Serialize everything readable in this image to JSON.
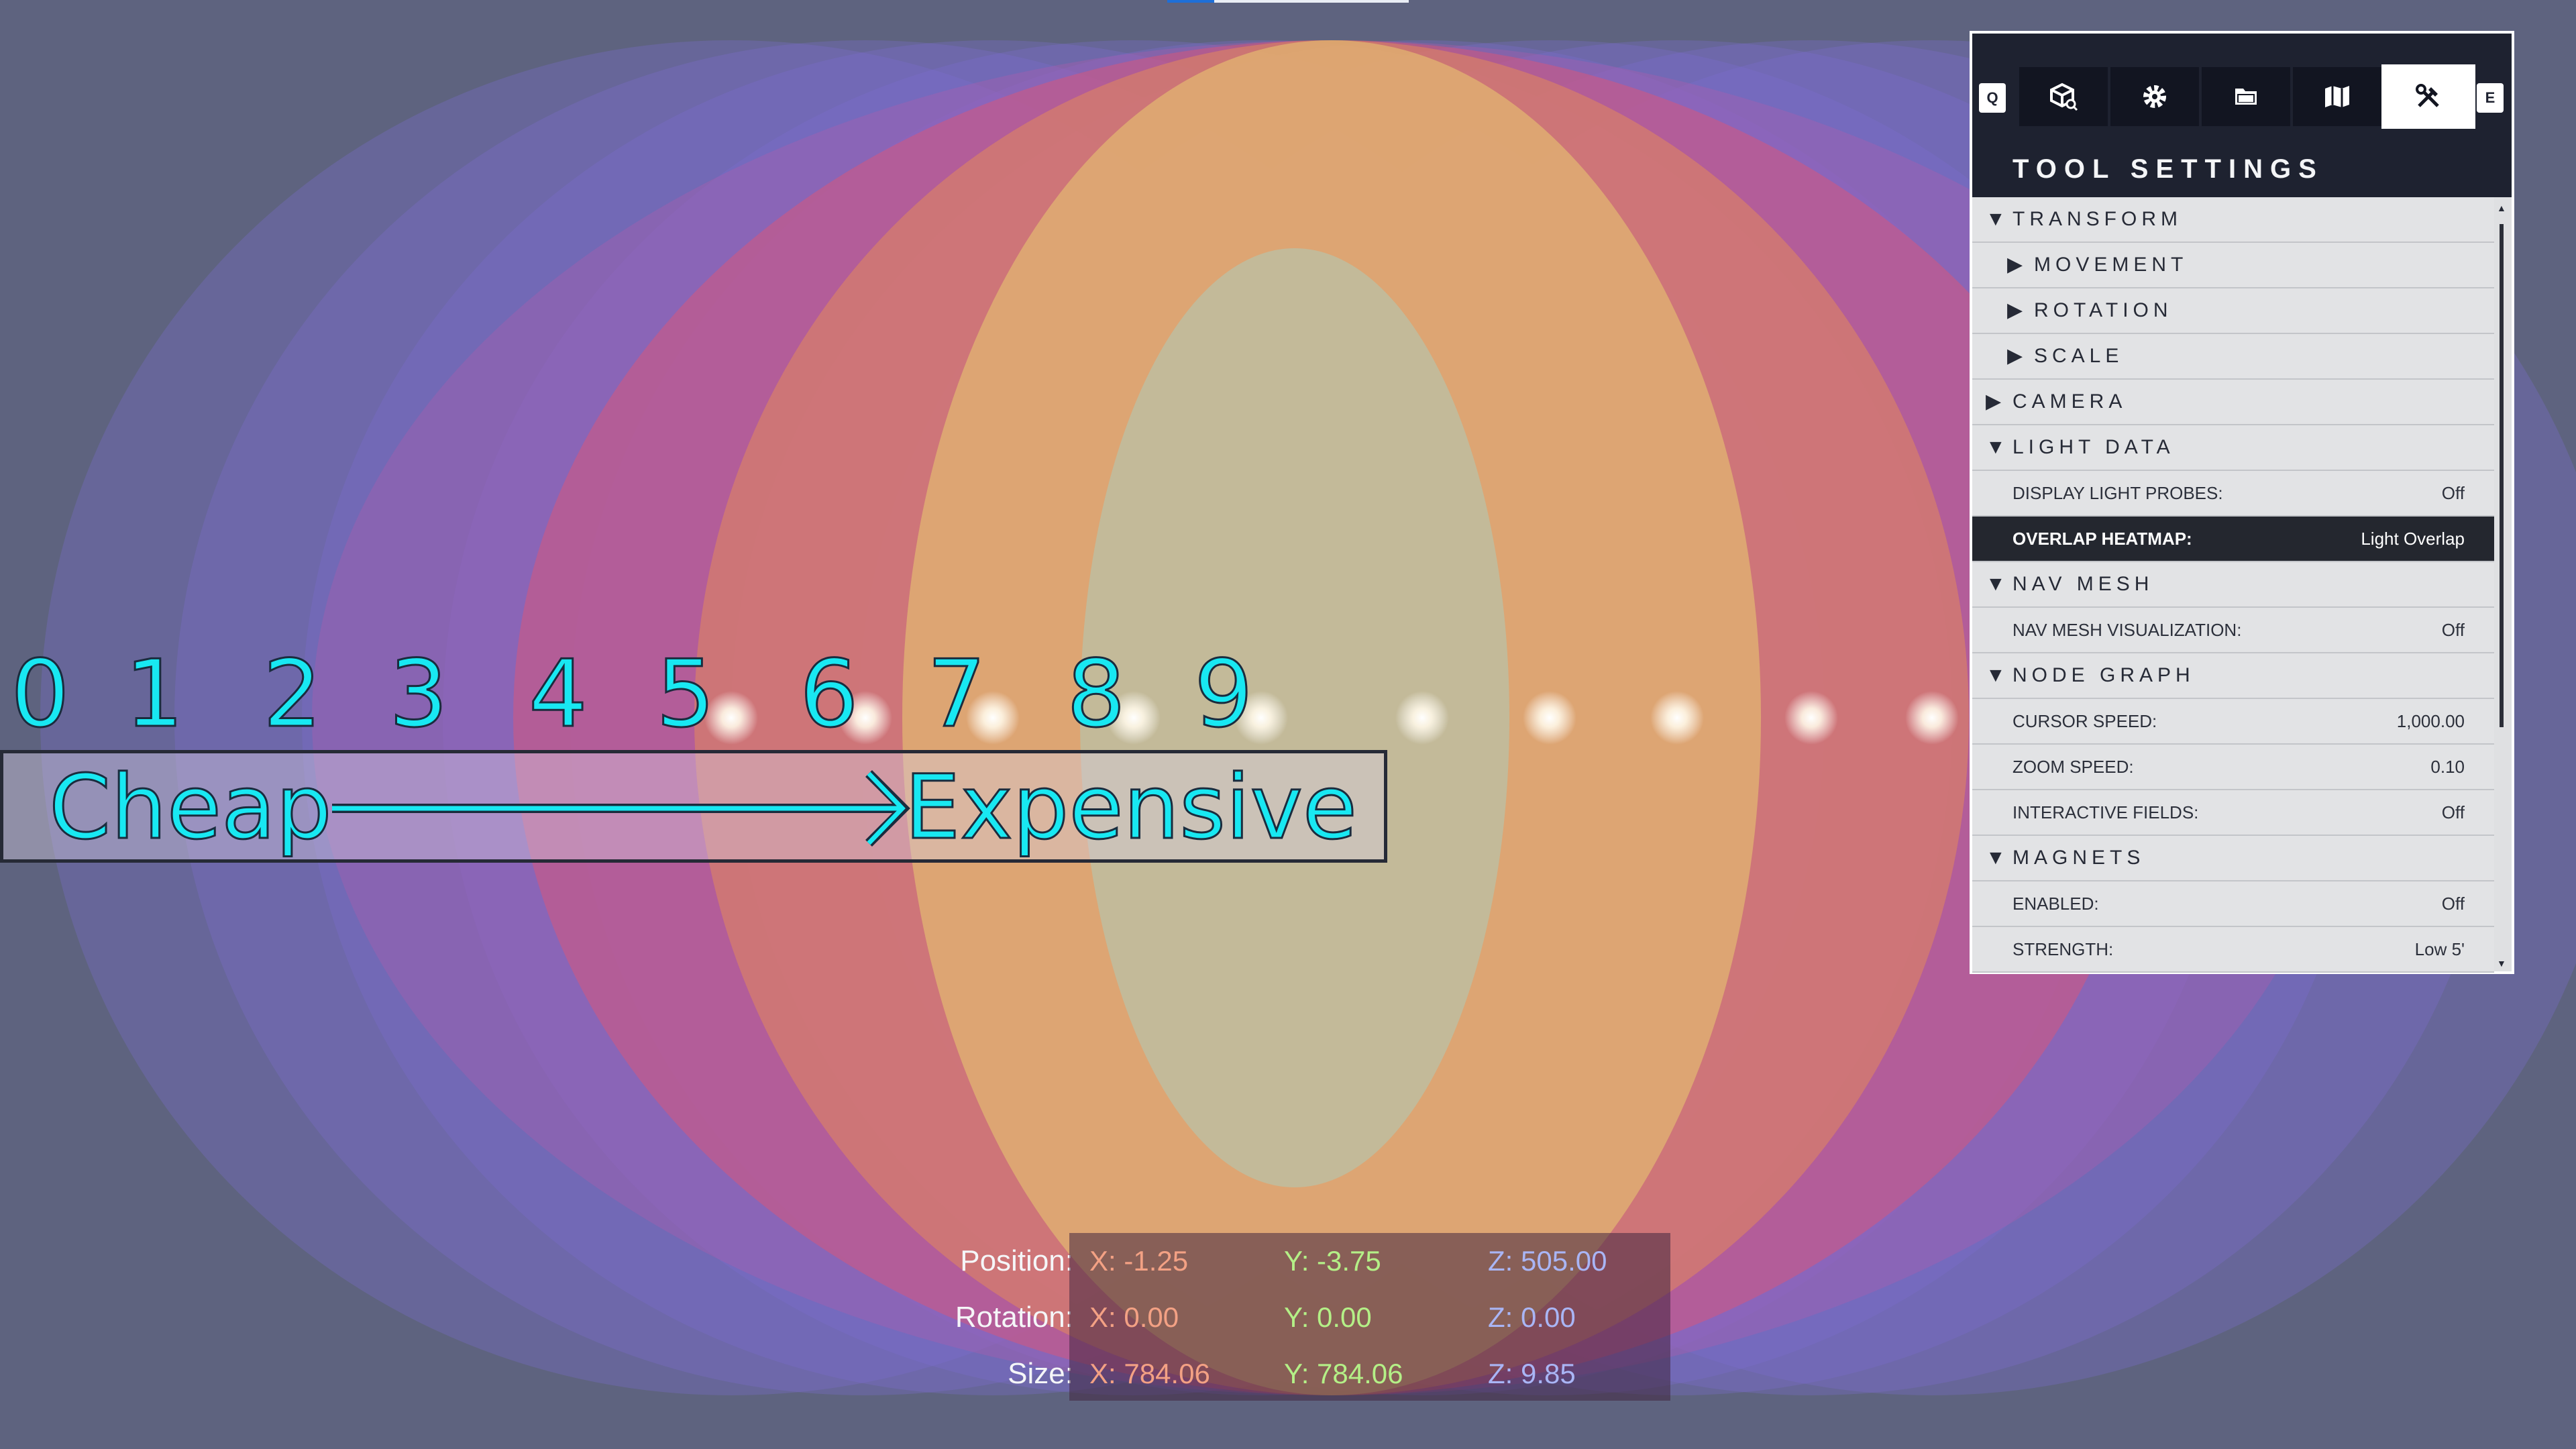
{
  "colors": {
    "background": "#5e637f",
    "heat_1": "#7b6ccf",
    "heat_2": "#b15cad",
    "heat_3": "#e45570",
    "heat_4": "#e88d55",
    "heat_5": "#e7c46f",
    "heat_6": "#bdbfa3",
    "legend_text": "#18e8f2",
    "readout_x": "#f3a184",
    "readout_y": "#b4f087",
    "readout_z": "#a9b5f5"
  },
  "legend": {
    "numbers": [
      "0",
      "1",
      "2",
      "3",
      "4",
      "5",
      "6",
      "7",
      "8",
      "9"
    ],
    "cheap_label": "Cheap",
    "expensive_label": "Expensive"
  },
  "tool_panel": {
    "left_key": "Q",
    "right_key": "E",
    "tabs": [
      {
        "icon": "object-browser-icon",
        "active": false
      },
      {
        "icon": "settings-gear-icon",
        "active": false
      },
      {
        "icon": "folder-icon",
        "active": false
      },
      {
        "icon": "map-icon",
        "active": false
      },
      {
        "icon": "tools-icon",
        "active": true
      }
    ],
    "title": "TOOL SETTINGS",
    "rows": [
      {
        "kind": "section",
        "label": "TRANSFORM",
        "expanded": true,
        "indent": 0
      },
      {
        "kind": "section",
        "label": "MOVEMENT",
        "expanded": false,
        "indent": 1
      },
      {
        "kind": "section",
        "label": "ROTATION",
        "expanded": false,
        "indent": 1
      },
      {
        "kind": "section",
        "label": "SCALE",
        "expanded": false,
        "indent": 1
      },
      {
        "kind": "section",
        "label": "CAMERA",
        "expanded": false,
        "indent": 0
      },
      {
        "kind": "section",
        "label": "LIGHT DATA",
        "expanded": true,
        "indent": 0
      },
      {
        "kind": "property",
        "label": "DISPLAY LIGHT PROBES:",
        "value": "Off",
        "selected": false
      },
      {
        "kind": "property",
        "label": "OVERLAP HEATMAP:",
        "value": "Light Overlap",
        "selected": true
      },
      {
        "kind": "section",
        "label": "NAV MESH",
        "expanded": true,
        "indent": 0
      },
      {
        "kind": "property",
        "label": "NAV MESH VISUALIZATION:",
        "value": "Off",
        "selected": false
      },
      {
        "kind": "section",
        "label": "NODE GRAPH",
        "expanded": true,
        "indent": 0
      },
      {
        "kind": "property",
        "label": "CURSOR SPEED:",
        "value": "1,000.00",
        "selected": false
      },
      {
        "kind": "property",
        "label": "ZOOM SPEED:",
        "value": "0.10",
        "selected": false
      },
      {
        "kind": "property",
        "label": "INTERACTIVE FIELDS:",
        "value": "Off",
        "selected": false
      },
      {
        "kind": "section",
        "label": "MAGNETS",
        "expanded": true,
        "indent": 0
      },
      {
        "kind": "property",
        "label": "ENABLED:",
        "value": "Off",
        "selected": false
      },
      {
        "kind": "property",
        "label": "STRENGTH:",
        "value": "Low 5'",
        "selected": false
      }
    ]
  },
  "transform_readout": {
    "position_label": "Position:",
    "rotation_label": "Rotation:",
    "size_label": "Size:",
    "position": {
      "x": "X: -1.25",
      "y": "Y: -3.75",
      "z": "Z: 505.00"
    },
    "rotation": {
      "x": "X: 0.00",
      "y": "Y: 0.00",
      "z": "Z: 0.00"
    },
    "size": {
      "x": "X: 784.06",
      "y": "Y: 784.06",
      "z": "Z: 9.85"
    }
  }
}
